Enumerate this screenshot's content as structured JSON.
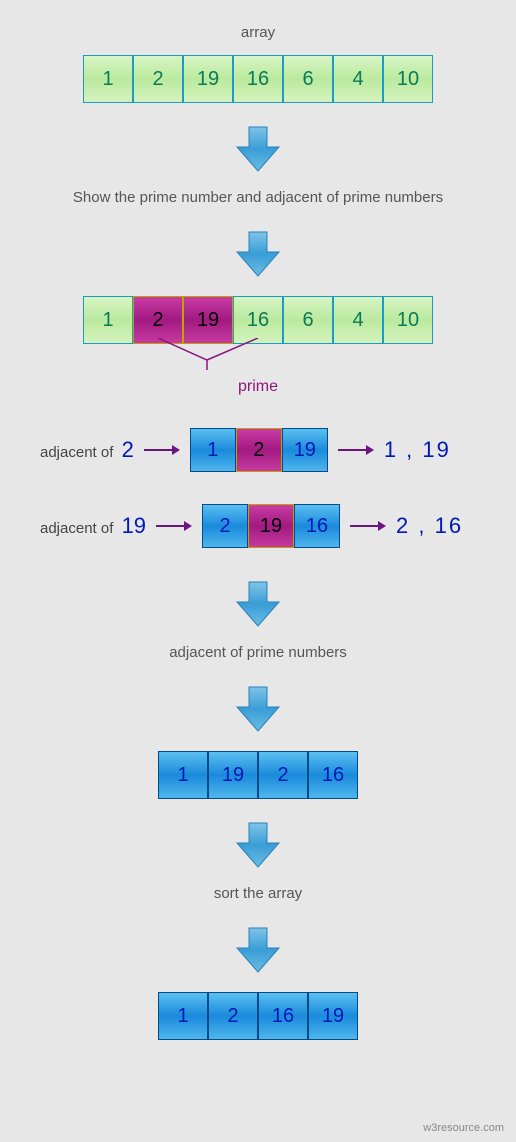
{
  "title": "array",
  "array1": [
    "1",
    "2",
    "19",
    "16",
    "6",
    "4",
    "10"
  ],
  "step1_text": "Show the prime number and adjacent of prime numbers",
  "array2": [
    {
      "v": "1",
      "t": "green"
    },
    {
      "v": "2",
      "t": "magenta"
    },
    {
      "v": "19",
      "t": "magenta"
    },
    {
      "v": "16",
      "t": "green"
    },
    {
      "v": "6",
      "t": "green"
    },
    {
      "v": "4",
      "t": "green"
    },
    {
      "v": "10",
      "t": "green"
    }
  ],
  "prime_label": "prime",
  "triplet1": {
    "label_prefix": "adjacent of ",
    "label_num": "2",
    "cells": [
      {
        "v": "1",
        "t": "blue"
      },
      {
        "v": "2",
        "t": "magenta"
      },
      {
        "v": "19",
        "t": "blue"
      }
    ],
    "result": "1 , 19"
  },
  "triplet2": {
    "label_prefix": "adjacent of ",
    "label_num": "19",
    "cells": [
      {
        "v": "2",
        "t": "blue"
      },
      {
        "v": "19",
        "t": "magenta"
      },
      {
        "v": "16",
        "t": "blue"
      }
    ],
    "result": "2 , 16"
  },
  "step2_text": "adjacent of prime numbers",
  "array3": [
    "1",
    "19",
    "2",
    "16"
  ],
  "step3_text": "sort the array",
  "array4": [
    "1",
    "2",
    "16",
    "19"
  ],
  "attribution": "w3resource.com"
}
